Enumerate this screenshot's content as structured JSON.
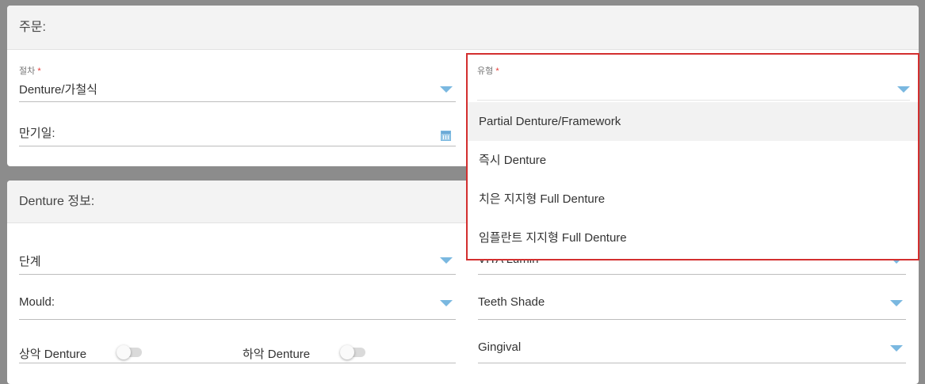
{
  "order_section": {
    "title": "주문:",
    "procedure": {
      "label": "절차",
      "required_mark": "*",
      "value": "Denture/가철식"
    },
    "due_date": {
      "label": "만기일:"
    },
    "type": {
      "label": "유형",
      "required_mark": "*",
      "value": "",
      "options": [
        "Partial Denture/Framework",
        "즉시 Denture",
        "치은 지지형 Full Denture",
        "임플란트 지지형 Full Denture"
      ]
    }
  },
  "denture_section": {
    "title": "Denture 정보:",
    "stage": {
      "label": "단계"
    },
    "shade_system": {
      "value": "VITA Lumin"
    },
    "mould": {
      "label": "Mould:"
    },
    "teeth_shade": {
      "label": "Teeth Shade"
    },
    "upper_jaw": {
      "label": "상악 Denture",
      "on": false
    },
    "lower_jaw": {
      "label": "하악 Denture",
      "on": false
    },
    "gingival": {
      "label": "Gingival"
    }
  },
  "colors": {
    "accent": "#7ab8e0",
    "required": "#e53935",
    "dropdown_border": "#d32f2f",
    "frame": "#8c8c8c"
  },
  "icons": [
    "chevron-down-icon",
    "calendar-icon"
  ]
}
